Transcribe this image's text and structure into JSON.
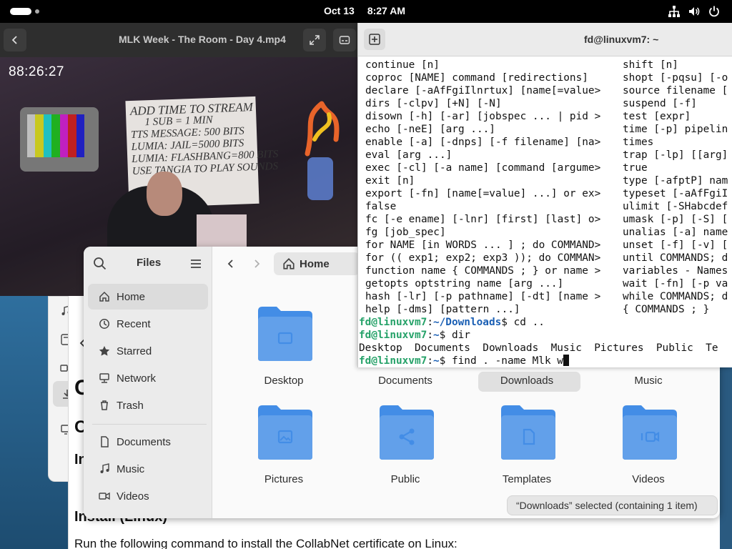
{
  "topbar": {
    "date": "Oct 13",
    "time": "8:27 AM",
    "icons": [
      "network-icon",
      "volume-icon",
      "power-icon"
    ]
  },
  "video": {
    "title": "MLK Week - The Room - Day 4.mp4",
    "timestamp": "88:26:27",
    "sign_lines": [
      "ADD TIME TO STREAM",
      "1 SUB = 1 MIN",
      "TTS MESSAGE: 500 BITS",
      "LUMIA: JAIL=5000 BITS",
      "LUMIA: FLASHBANG=800 BITS",
      "USE TANGIA TO PLAY SOUNDS"
    ]
  },
  "terminal": {
    "title": "fd@linuxvm7: ~",
    "help_left": [
      "continue [n]",
      "coproc [NAME] command [redirections]",
      "declare [-aAfFgiIlnrtux] [name[=value>",
      "dirs [-clpv] [+N] [-N]",
      "disown [-h] [-ar] [jobspec ... | pid >",
      "echo [-neE] [arg ...]",
      "enable [-a] [-dnps] [-f filename] [na>",
      "eval [arg ...]",
      "exec [-cl] [-a name] [command [argume>",
      "exit [n]",
      "export [-fn] [name[=value] ...] or ex>",
      "false",
      "fc [-e ename] [-lnr] [first] [last] o>",
      "fg [job_spec]",
      "for NAME [in WORDS ... ] ; do COMMAND>",
      "for (( exp1; exp2; exp3 )); do COMMAN>",
      "function name { COMMANDS ; } or name >",
      "getopts optstring name [arg ...]",
      "hash [-lr] [-p pathname] [-dt] [name >",
      "help [-dms] [pattern ...]"
    ],
    "help_right": [
      "shift [n]",
      "shopt [-pqsu] [-o",
      "source filename [",
      "suspend [-f]",
      "test [expr]",
      "time [-p] pipelin",
      "times",
      "trap [-lp] [[arg]",
      "true",
      "type [-afptP] nam",
      "typeset [-aAfFgiI",
      "ulimit [-SHabcdef",
      "umask [-p] [-S] [",
      "unalias [-a] name",
      "unset [-f] [-v] [",
      "until COMMANDS; d",
      "variables - Names",
      "wait [-fn] [-p va",
      "while COMMANDS; d",
      "{ COMMANDS ; }"
    ],
    "line_cd": {
      "user": "fd@linuxvm7",
      "sep": ":",
      "path": "~/Downloads",
      "cmd": "$ cd .."
    },
    "line_dir": {
      "user": "fd@linuxvm7",
      "sep": ":",
      "path": "~",
      "cmd": "$ dir"
    },
    "dir_output": "Desktop  Documents  Downloads  Music  Pictures  Public  Te",
    "line_find": {
      "user": "fd@linuxvm7",
      "sep": ":",
      "path": "~",
      "cmd": "$ find . -name Mlk w"
    }
  },
  "files": {
    "sidebar_title": "Files",
    "sidebar_items": [
      {
        "label": "Home",
        "icon": "home-icon",
        "active": true
      },
      {
        "label": "Recent",
        "icon": "clock-icon"
      },
      {
        "label": "Starred",
        "icon": "star-icon"
      },
      {
        "label": "Network",
        "icon": "network-icon"
      },
      {
        "label": "Trash",
        "icon": "trash-icon"
      }
    ],
    "sidebar_bookmarks": [
      {
        "label": "Documents",
        "icon": "document-icon"
      },
      {
        "label": "Music",
        "icon": "music-icon"
      },
      {
        "label": "Videos",
        "icon": "video-icon"
      }
    ],
    "path_label": "Home",
    "folders": [
      "Desktop",
      "Documents",
      "Downloads",
      "Music",
      "Pictures",
      "Public",
      "Templates",
      "Videos"
    ],
    "selected_folder": "Downloads",
    "status": "“Downloads” selected  (containing 1 item)"
  },
  "browser": {
    "heading_install": "Install (Linux)",
    "run_text": "Run the following command to install the CollabNet certificate on Linux:",
    "letters": [
      "C",
      "C",
      "In"
    ]
  },
  "colors": {
    "folder_blue": "#62a0ea",
    "folder_dark": "#438de6",
    "prompt_green": "#26a269",
    "prompt_blue": "#1a5fb4"
  }
}
